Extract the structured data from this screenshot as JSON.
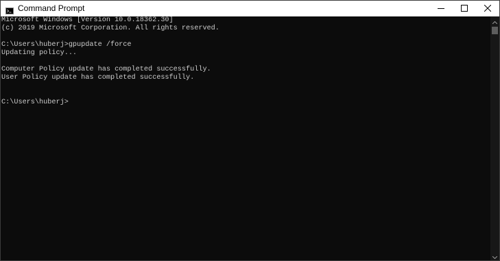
{
  "window": {
    "title": "Command Prompt",
    "app_icon": "cmd-icon",
    "buttons": [
      {
        "name": "minimize",
        "icon": "minimize-icon"
      },
      {
        "name": "maximize",
        "icon": "maximize-icon"
      },
      {
        "name": "close",
        "icon": "close-icon"
      }
    ]
  },
  "console": {
    "lines": [
      "Microsoft Windows [Version 10.0.18362.30]",
      "(c) 2019 Microsoft Corporation. All rights reserved.",
      "",
      "C:\\Users\\huberj>gpupdate /force",
      "Updating policy...",
      "",
      "Computer Policy update has completed successfully.",
      "User Policy update has completed successfully.",
      "",
      "",
      "C:\\Users\\huberj>"
    ]
  },
  "colors": {
    "console_background": "#0c0c0c",
    "console_text": "#cccccc",
    "titlebar_background": "#ffffff"
  }
}
